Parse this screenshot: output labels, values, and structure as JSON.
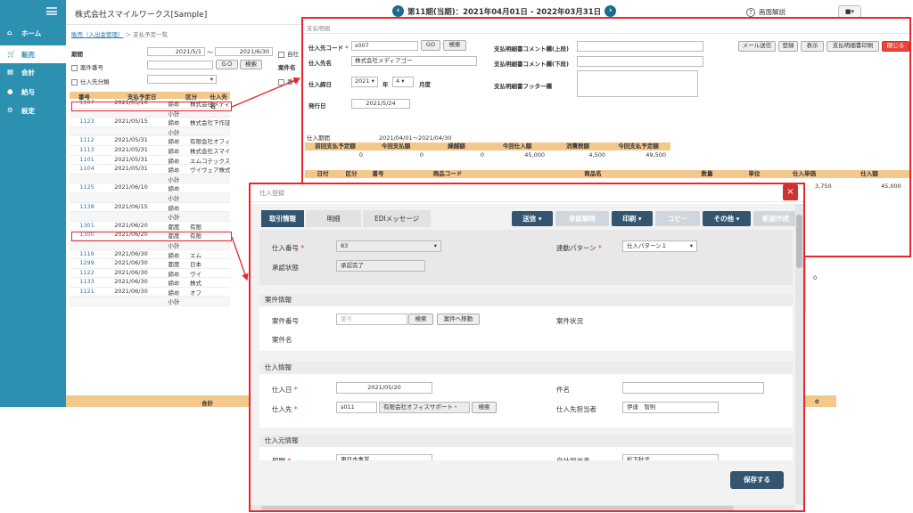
{
  "sidebar": {
    "items": [
      {
        "label": "ホーム"
      },
      {
        "label": "販売"
      },
      {
        "label": "会計"
      },
      {
        "label": "給与"
      },
      {
        "label": "設定"
      }
    ]
  },
  "header": {
    "company": "株式会社スマイルワークス[Sample]",
    "period": "第11期(当期)：2021年04月01日 - 2022年03月31日",
    "help": "画面解説",
    "user_caret": "▾"
  },
  "breadcrumb": {
    "link": "販売（入出金管理）",
    "sep": "＞",
    "current": "支払予定一覧"
  },
  "search": {
    "period_label": "期間",
    "from": "2021/5/1",
    "to": "2021/6/30",
    "tilde": "〜",
    "case_label": "案件番号",
    "go": "ＧＯ",
    "search_btn": "検索",
    "case_name_label": "案件名",
    "class_label": "仕入先分類",
    "self_label": "自社",
    "num_label": "番号",
    "dd": "▾"
  },
  "bgtable": {
    "headers": [
      "番号",
      "支払予定日",
      "区分",
      "仕入先名"
    ],
    "rows": [
      {
        "no": "1107",
        "date": "2021/05/10",
        "kind": "締め",
        "name": "株式会社メディアゴー"
      },
      {
        "no": "",
        "date": "",
        "kind": "小計",
        "name": ""
      },
      {
        "no": "1123",
        "date": "2021/05/15",
        "kind": "締め",
        "name": "株式会社下作証"
      },
      {
        "no": "",
        "date": "",
        "kind": "小計",
        "name": ""
      },
      {
        "no": "1112",
        "date": "2021/05/31",
        "kind": "締め",
        "name": "有限会社オフィスサポート・サ"
      },
      {
        "no": "1113",
        "date": "2021/05/31",
        "kind": "締め",
        "name": "株式会社スマイルサービス"
      },
      {
        "no": "1101",
        "date": "2021/05/31",
        "kind": "締め",
        "name": "エムコテックス株式会社"
      },
      {
        "no": "1104",
        "date": "2021/05/31",
        "kind": "締め",
        "name": "ヴイヴェア株式会社"
      },
      {
        "no": "",
        "date": "",
        "kind": "小計",
        "name": ""
      },
      {
        "no": "1125",
        "date": "2021/06/10",
        "kind": "締め",
        "name": ""
      },
      {
        "no": "",
        "date": "",
        "kind": "小計",
        "name": ""
      },
      {
        "no": "1138",
        "date": "2021/06/15",
        "kind": "締め",
        "name": ""
      },
      {
        "no": "",
        "date": "",
        "kind": "小計",
        "name": ""
      },
      {
        "no": "1301",
        "date": "2021/06/20",
        "kind": "都度",
        "name": "有限"
      },
      {
        "no": "1300",
        "date": "2021/06/20",
        "kind": "都度",
        "name": "有限"
      },
      {
        "no": "",
        "date": "",
        "kind": "小計",
        "name": ""
      },
      {
        "no": "1119",
        "date": "2021/06/30",
        "kind": "締め",
        "name": "エム"
      },
      {
        "no": "1299",
        "date": "2021/06/30",
        "kind": "都度",
        "name": "日本"
      },
      {
        "no": "1122",
        "date": "2021/06/30",
        "kind": "締め",
        "name": "ヴイ"
      },
      {
        "no": "1133",
        "date": "2021/06/30",
        "kind": "締め",
        "name": "株式"
      },
      {
        "no": "1121",
        "date": "2021/06/30",
        "kind": "締め",
        "name": "オフ"
      },
      {
        "no": "",
        "date": "",
        "kind": "小計",
        "name": ""
      }
    ],
    "total_label": "合計",
    "right_zero": "0"
  },
  "pay": {
    "title": "支払明細",
    "code_label": "仕入先コード",
    "code": "s007",
    "go": "GO",
    "search_btn": "検索",
    "name_label": "仕入先名",
    "name": "株式会社メディアゴー",
    "close_label": "仕入締日",
    "year": "2021",
    "year_unit": "年",
    "month": "4",
    "month_unit": "月度",
    "issue_label": "発行日",
    "issue": "2021/5/24",
    "cmt_top_label": "支払明細書コメント欄(上段)",
    "cmt_bot_label": "支払明細書コメント欄(下段)",
    "footer_label": "支払明細書フッター欄",
    "buttons": [
      "メール送信",
      "登録",
      "表示",
      "支払明細書印刷",
      "閉じる"
    ],
    "period_label": "仕入期間",
    "period": "2021/04/01～2021/04/30",
    "sum_headers": [
      "前回支払予定額",
      "今回支払額",
      "繰越額",
      "今回仕入額",
      "消費税額",
      "今回支払予定額"
    ],
    "sum_values": [
      "0",
      "0",
      "0",
      "45,000",
      "4,500",
      "49,500"
    ],
    "detail_headers": [
      "日付",
      "区分",
      "番号",
      "商品コード",
      "商品名",
      "数量",
      "単位",
      "仕入単価",
      "仕入額"
    ],
    "detail_row": [
      "3,750",
      "45,000"
    ]
  },
  "dlg": {
    "title": "仕入登録",
    "close": "×",
    "tabs": [
      "取引情報",
      "明細",
      "EDIメッセージ"
    ],
    "actions": [
      "送信 ▾",
      "承認解除",
      "印刷 ▾",
      "コピー",
      "その他 ▾",
      "新規作成"
    ],
    "purchase_no_label": "仕入番号",
    "purchase_no": "83",
    "pattern_label": "連動パターン",
    "pattern": "仕入パターン１",
    "approval_label": "承認状態",
    "approval": "承認完了",
    "case_section": "案件情報",
    "case_no_label": "案件番号",
    "case_no_ph": "番号",
    "search_btn": "検索",
    "case_move": "案件へ移動",
    "case_status_label": "案件状況",
    "case_name_label": "案件名",
    "purchase_section": "仕入情報",
    "date_label": "仕入日",
    "date": "2021/05/20",
    "subject_label": "件名",
    "vendor_label": "仕入先",
    "vendor_code": "s011",
    "vendor_name": "有限会社オフィスサポート・",
    "vendor_contact_label": "仕入先担当者",
    "vendor_contact": "伊達　智則",
    "origin_section": "仕入元情報",
    "dept_label": "部門",
    "dept": "東日本事業",
    "self_contact_label": "自社担当者",
    "self_contact": "松下秋子",
    "save": "保存する"
  },
  "colors": {
    "sidebar": "#2c90b0",
    "header_orange": "#f3c88d",
    "red_frame": "#e8262b",
    "dark_btn": "#33556f"
  }
}
